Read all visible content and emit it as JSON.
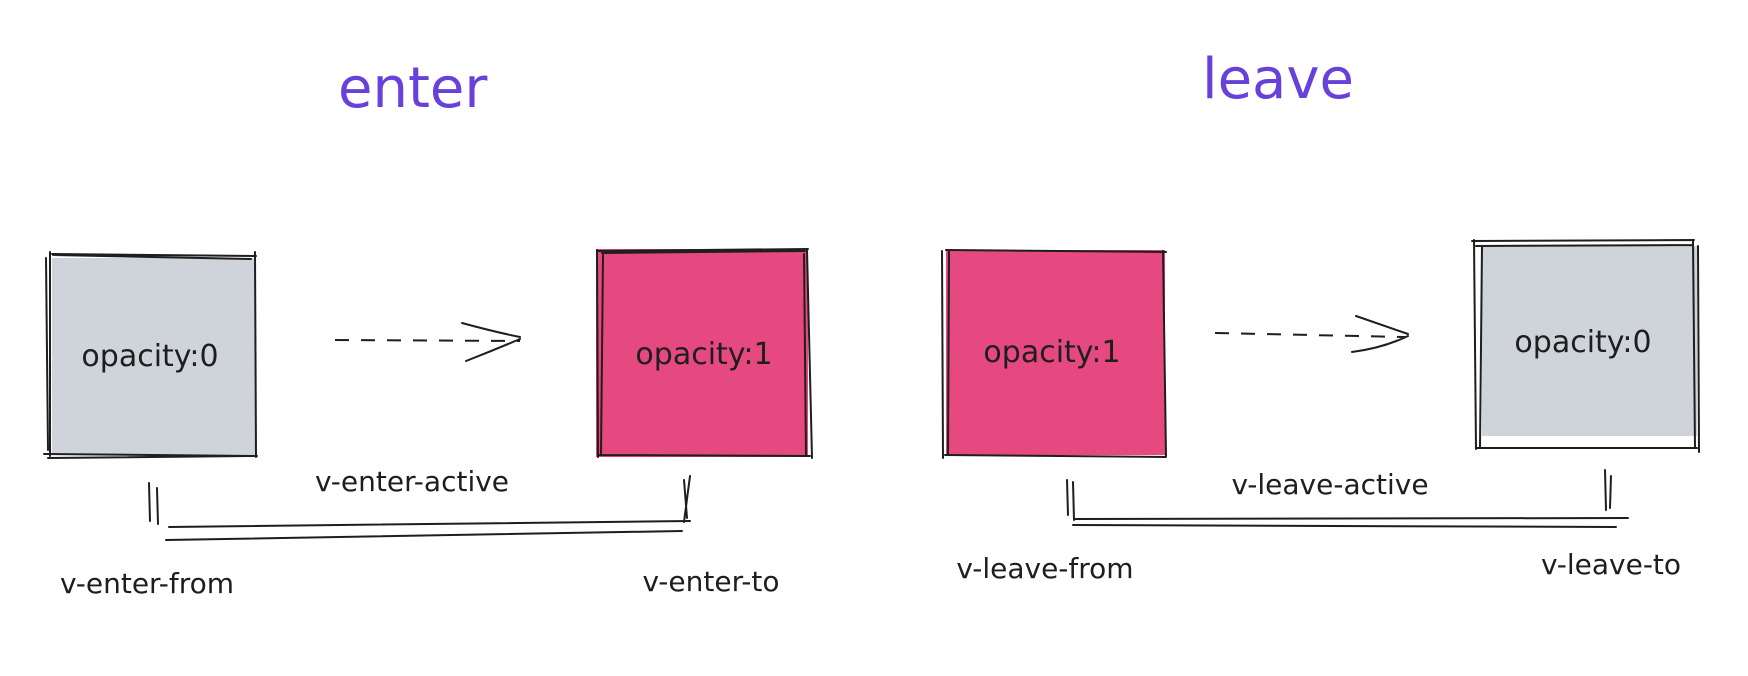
{
  "colors": {
    "title": "#6741d9",
    "hidden_fill": "#ced4da",
    "visible_fill": "#e64980",
    "ink": "#1e1e1e"
  },
  "enter": {
    "title": "enter",
    "from_box": {
      "label": "opacity:0",
      "state": "hidden"
    },
    "to_box": {
      "label": "opacity:1",
      "state": "visible"
    },
    "active_label": "v-enter-active",
    "from_label": "v-enter-from",
    "to_label": "v-enter-to"
  },
  "leave": {
    "title": "leave",
    "from_box": {
      "label": "opacity:1",
      "state": "visible"
    },
    "to_box": {
      "label": "opacity:0",
      "state": "hidden"
    },
    "active_label": "v-leave-active",
    "from_label": "v-leave-from",
    "to_label": "v-leave-to"
  }
}
